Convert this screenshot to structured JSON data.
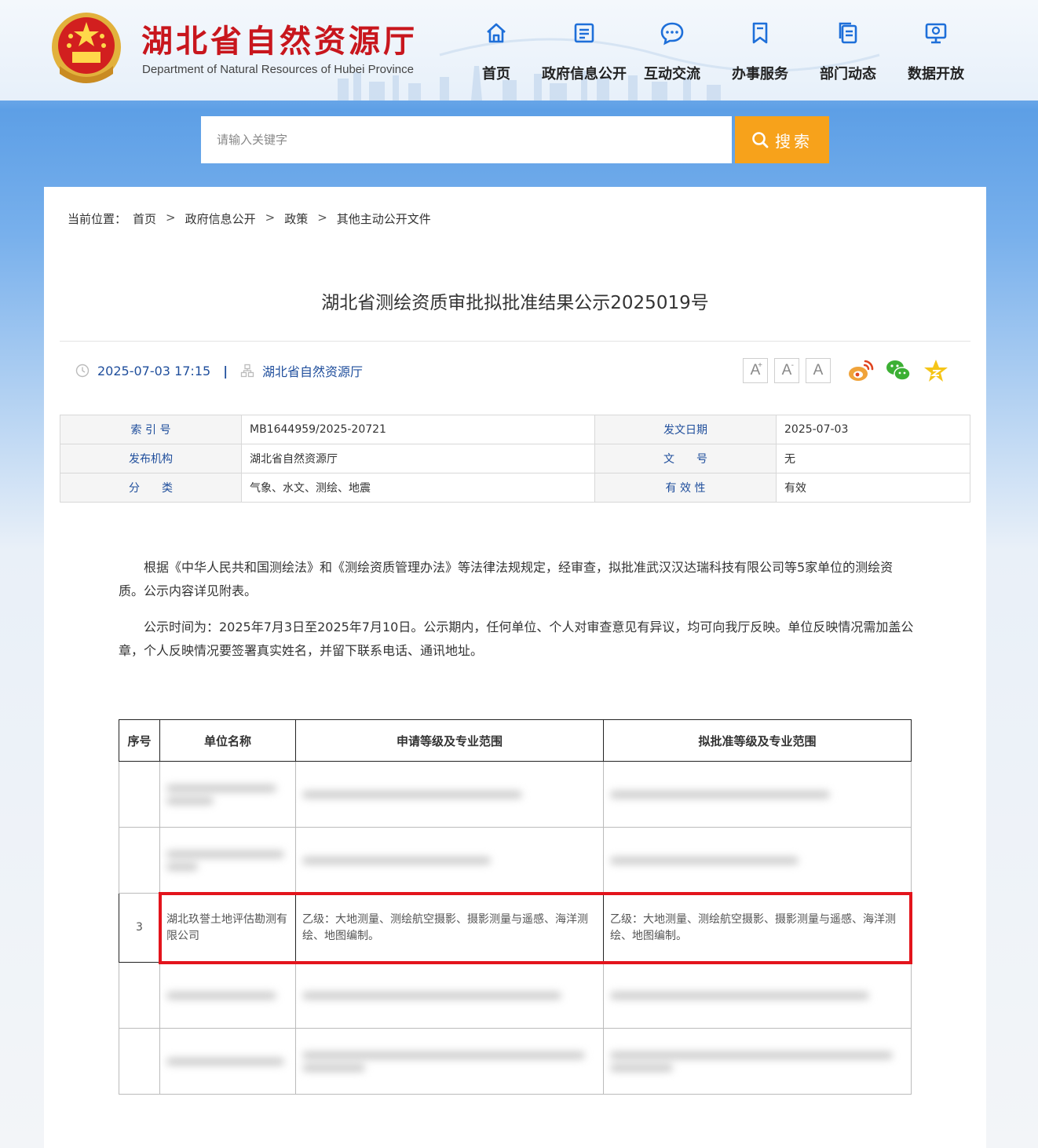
{
  "header": {
    "site_title": "湖北省自然资源厅",
    "site_subtitle": "Department of Natural Resources of Hubei Province",
    "nav": [
      {
        "label": "首页",
        "icon": "home-icon"
      },
      {
        "label": "政府信息公开",
        "icon": "document-icon"
      },
      {
        "label": "互动交流",
        "icon": "chat-bubble-icon"
      },
      {
        "label": "办事服务",
        "icon": "bookmark-icon"
      },
      {
        "label": "部门动态",
        "icon": "copy-document-icon"
      },
      {
        "label": "数据开放",
        "icon": "data-screen-icon"
      }
    ]
  },
  "search": {
    "placeholder": "请输入关键字",
    "button_label": "搜索"
  },
  "breadcrumb": {
    "prefix": "当前位置：",
    "items": [
      "首页",
      "政府信息公开",
      "政策",
      "其他主动公开文件"
    ],
    "separator": ">"
  },
  "article": {
    "title": "湖北省测绘资质审批拟批准结果公示2025019号",
    "datetime": "2025-07-03 17:15",
    "publisher": "湖北省自然资源厅",
    "font_buttons": [
      "A",
      "A",
      "A"
    ],
    "share": [
      "weibo-icon",
      "wechat-icon",
      "favorite-star-icon"
    ]
  },
  "info_table": [
    {
      "label1": "索 引 号",
      "value1": "MB1644959/2025-20721",
      "label2": "发文日期",
      "value2": "2025-07-03"
    },
    {
      "label1": "发布机构",
      "value1": "湖北省自然资源厅",
      "label2": "文　　号",
      "value2": "无"
    },
    {
      "label1": "分　　类",
      "value1": "气象、水文、测绘、地震",
      "label2": "有 效 性",
      "value2": "有效"
    }
  ],
  "body": {
    "paragraphs": [
      "根据《中华人民共和国测绘法》和《测绘资质管理办法》等法律法规规定，经审查，拟批准武汉汉达瑞科技有限公司等5家单位的测绘资质。公示内容详见附表。",
      "公示时间为：2025年7月3日至2025年7月10日。公示期内，任何单位、个人对审查意见有异议，均可向我厅反映。单位反映情况需加盖公章，个人反映情况要签署真实姓名，并留下联系电话、通讯地址。"
    ]
  },
  "annex_table": {
    "headers": [
      "序号",
      "单位名称",
      "申请等级及专业范围",
      "拟批准等级及专业范围"
    ],
    "visible_row": {
      "index": "3",
      "name": "湖北玖誉土地评估勘测有限公司",
      "applied": "乙级：大地测量、测绘航空摄影、摄影测量与遥感、海洋测绘、地图编制。",
      "approved": "乙级：大地测量、测绘航空摄影、摄影测量与遥感、海洋测绘、地图编制。"
    }
  },
  "colors": {
    "brand_red": "#c8161d",
    "search_orange": "#f7a21b",
    "link_blue": "#1f4e9c",
    "highlight_red": "#e3141c"
  }
}
